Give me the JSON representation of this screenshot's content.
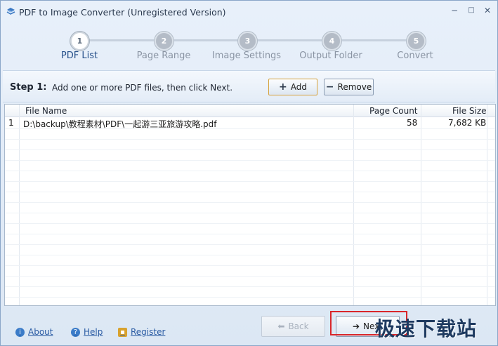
{
  "window": {
    "title": "PDF to Image Converter (Unregistered Version)",
    "minimize_glyph": "−",
    "maximize_glyph": "□",
    "close_glyph": "✕"
  },
  "steps": [
    {
      "number": "1",
      "label": "PDF List",
      "active": true
    },
    {
      "number": "2",
      "label": "Page Range",
      "active": false
    },
    {
      "number": "3",
      "label": "Image Settings",
      "active": false
    },
    {
      "number": "4",
      "label": "Output Folder",
      "active": false
    },
    {
      "number": "5",
      "label": "Convert",
      "active": false
    }
  ],
  "step_bar": {
    "title": "Step 1:",
    "description": "Add one or more PDF files, then click Next.",
    "add_label": "Add",
    "remove_label": "Remove"
  },
  "table": {
    "columns": [
      "File Name",
      "Page Count",
      "File Size"
    ],
    "rows": [
      {
        "index": "1",
        "file": "D:\\backup\\教程素材\\PDF\\一起游三亚旅游攻略.pdf",
        "pages": "58",
        "size": "7,682 KB"
      }
    ]
  },
  "footer": {
    "about": "About",
    "help": "Help",
    "register": "Register",
    "back": "Back",
    "next": "Next"
  },
  "watermark": "极速下载站",
  "colors": {
    "accent": "#26508a",
    "highlight": "#d9262a",
    "link": "#2a5ba3"
  },
  "icons": [
    "app-icon",
    "minimize-icon",
    "maximize-icon",
    "close-icon",
    "plus-icon",
    "minus-icon",
    "info-icon",
    "help-icon",
    "lock-icon",
    "back-arrow-icon",
    "next-arrow-icon"
  ]
}
